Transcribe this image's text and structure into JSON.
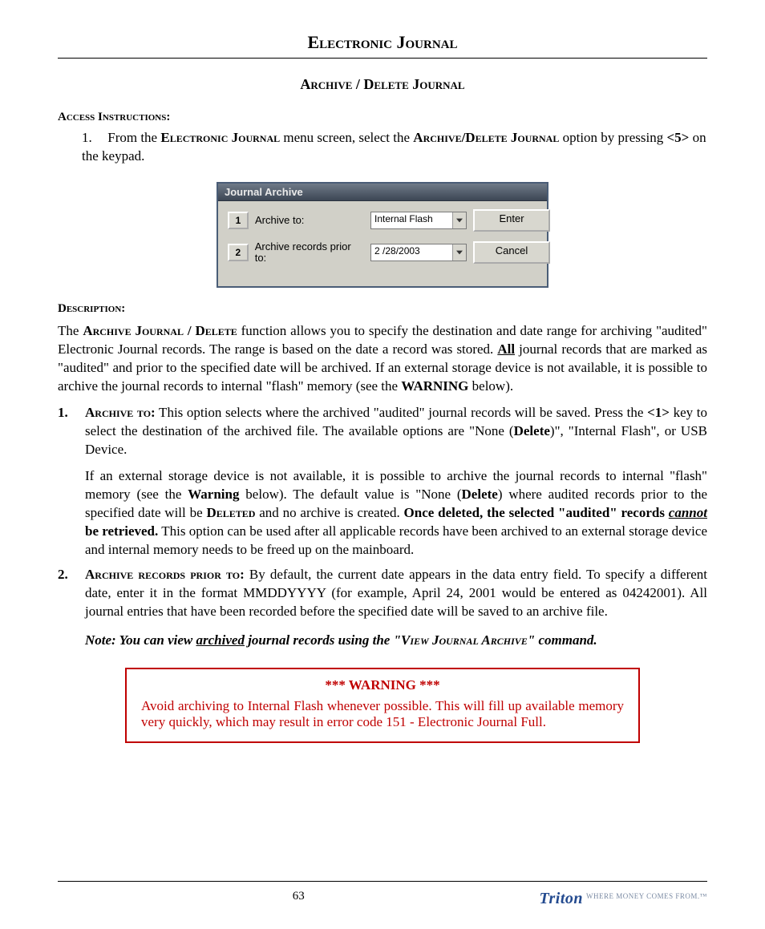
{
  "header": {
    "title": "Electronic Journal"
  },
  "section": {
    "title": "Archive / Delete Journal"
  },
  "access": {
    "heading": "Access Instructions:",
    "item_num": "1.",
    "pre": "From the ",
    "menu": "Electronic Journal",
    "mid1": " menu screen, select the ",
    "option": "Archive/Delete Journal",
    "mid2": " option by pressing ",
    "key": "<5>",
    "tail": " on the keypad."
  },
  "dialog": {
    "title": "Journal Archive",
    "row1": {
      "key": "1",
      "label": "Archive to:",
      "value": "Internal Flash",
      "button": "Enter"
    },
    "row2": {
      "key": "2",
      "label": "Archive records prior to:",
      "value": "2 /28/2003",
      "button": "Cancel"
    }
  },
  "description": {
    "heading": "Description:",
    "p1a": "The ",
    "p1b": "Archive Journal / Delete",
    "p1c": " function allows you to specify the destination and date range for archiving \"audited\" Electronic Journal records. The range is based on the date a record was stored.  ",
    "p1d": "All",
    "p1e": "  journal records that are marked as \"audited\" and  prior  to the specified date will be  archived. If an external storage device is not available, it is possible to archive the journal records to internal \"flash\" memory (see the ",
    "p1f": "WARNING",
    "p1g": " below)."
  },
  "list": {
    "i1": {
      "marker": "1.",
      "label": "Archive to:",
      "p1": "  This option selects where the archived \"audited\" journal records will  be saved. Press the ",
      "key": "<1>",
      "p2": " key to select the destination of the archived file. The available options are \"None (",
      "del": "Delete",
      "p3": ")\", \"Internal Flash\", or USB Device.",
      "para2a": " If an external storage device is not available, it is possible to archive the journal records to internal \"flash\" memory (see the ",
      "warn": "Warning",
      "para2b": " below). The default value is \"None (",
      "del2": "Delete",
      "para2c": ") where audited records prior to the specified date will be ",
      "deleted": "Deleted",
      "para2d": " and no archive is created. ",
      "strong": "Once deleted, the selected \"audited\" records ",
      "cannot": "cannot",
      "strong2": " be retrieved.",
      "para2e": "  This option can be used after all applicable records have been archived to an external storage device and internal memory needs to be freed up on the mainboard."
    },
    "i2": {
      "marker": "2.",
      "label": "Archive records prior to:",
      "text": "  By default, the current date appears in the data entry field. To specify a different date, enter it in the format MMDDYYYY (for example, April 24, 2001 would be entered as 04242001).  All journal entries that have been recorded before the specified date will be saved to an archive file."
    }
  },
  "note": {
    "a": "Note: You can view ",
    "u": "archived",
    "b": " journal records using the \"",
    "cmd": "View  Journal Archive",
    "c": "\" command."
  },
  "warning": {
    "title": "*** WARNING ***",
    "text": "Avoid archiving to Internal Flash whenever possible. This will fill up available memory very quickly, which  may result in error code 151 - Electronic Journal Full."
  },
  "footer": {
    "page": "63",
    "logo": "Triton",
    "tag": "WHERE MONEY COMES FROM.™"
  }
}
